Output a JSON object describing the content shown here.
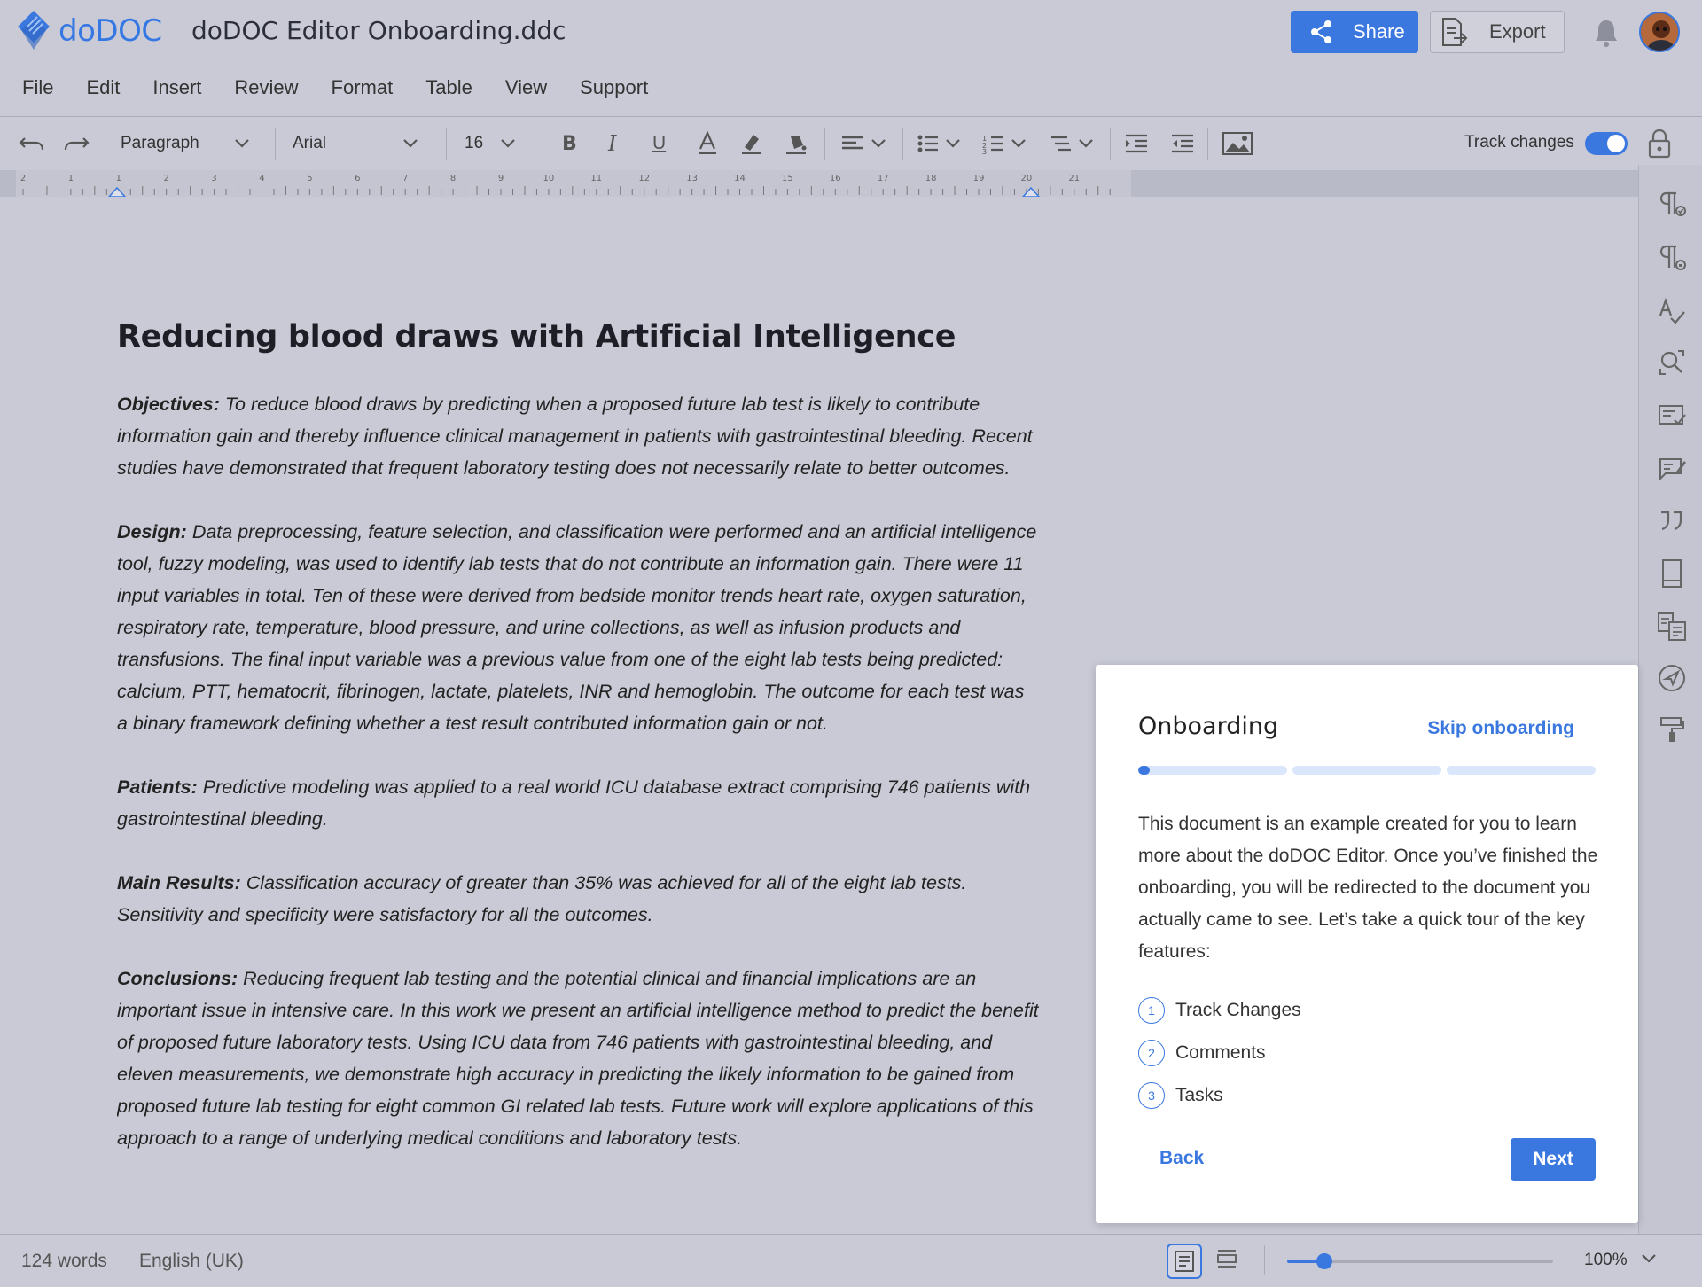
{
  "app": {
    "logo_text": "doDOC",
    "document_title": "doDOC Editor Onboarding.ddc",
    "brand_color": "#3a78e0"
  },
  "header": {
    "share_label": "Share",
    "export_label": "Export"
  },
  "menu": {
    "items": [
      "File",
      "Edit",
      "Insert",
      "Review",
      "Format",
      "Table",
      "View",
      "Support"
    ]
  },
  "toolbar": {
    "paragraph_style": "Paragraph",
    "font": "Arial",
    "font_size": "16",
    "track_changes_label": "Track changes",
    "track_changes_on": true
  },
  "ruler": {
    "ticks": [
      "2",
      "1",
      "1",
      "2",
      "3",
      "4",
      "5",
      "6",
      "7",
      "8",
      "9",
      "10",
      "11",
      "12",
      "13",
      "14",
      "15",
      "16",
      "17",
      "18",
      "19",
      "20",
      "21"
    ]
  },
  "document": {
    "title": "Reducing blood draws with Artificial Intelligence",
    "sections": [
      {
        "label": "Objectives:",
        "text": " To reduce blood draws by predicting when a proposed future lab test is likely to contribute information gain and thereby influence clinical management in patients with gastrointestinal bleeding. Recent studies have demonstrated that frequent laboratory testing does not necessarily relate to better outcomes."
      },
      {
        "label": "Design:",
        "text": " Data preprocessing, feature selection, and classification were performed and an artificial intelligence tool, fuzzy modeling, was used to identify lab tests that do not contribute an information gain. There were 11 input variables in total. Ten of these were derived from bedside monitor trends heart rate, oxygen saturation, respiratory rate, temperature, blood pressure, and urine collections, as well as infusion products and transfusions. The final input variable was a previous value from one of the eight lab tests being predicted: calcium, PTT, hematocrit, fibrinogen, lactate, platelets, INR and hemoglobin. The outcome for each test was a binary framework defining whether a test result contributed information gain or not."
      },
      {
        "label": "Patients:",
        "text": " Predictive modeling was applied to a real world ICU database extract comprising 746 patients with gastrointestinal bleeding."
      },
      {
        "label": "Main Results:",
        "text": " Classification accuracy of greater than 35% was achieved for all of the eight lab tests. Sensitivity and specificity were satisfactory for all the outcomes."
      },
      {
        "label": "Conclusions:",
        "text": " Reducing frequent lab testing and the potential clinical and financial implications are an important issue in intensive care. In this work we present an artificial intelligence method to predict the benefit of proposed future laboratory tests. Using ICU data from 746 patients with gastrointestinal bleeding, and eleven measurements, we demonstrate high accuracy in predicting the likely information to be gained from proposed future lab testing for eight common GI related lab tests. Future work will explore applications of this approach to a range of underlying medical conditions and laboratory tests."
      }
    ]
  },
  "onboarding": {
    "title": "Onboarding",
    "skip_label": "Skip onboarding",
    "progress_fraction": 0.025,
    "body": "This document is an example created for you to learn more about the doDOC Editor. Once you’ve finished the onboarding, you will be redirected to the document you actually came to see. Let’s take a quick tour of the key features:",
    "steps": [
      {
        "num": "1",
        "label": "Track Changes"
      },
      {
        "num": "2",
        "label": "Comments"
      },
      {
        "num": "3",
        "label": "Tasks"
      }
    ],
    "back_label": "Back",
    "next_label": "Next"
  },
  "status": {
    "word_count": "124 words",
    "language": "English (UK)",
    "zoom_label": "100%",
    "zoom_fraction": 0.14
  }
}
